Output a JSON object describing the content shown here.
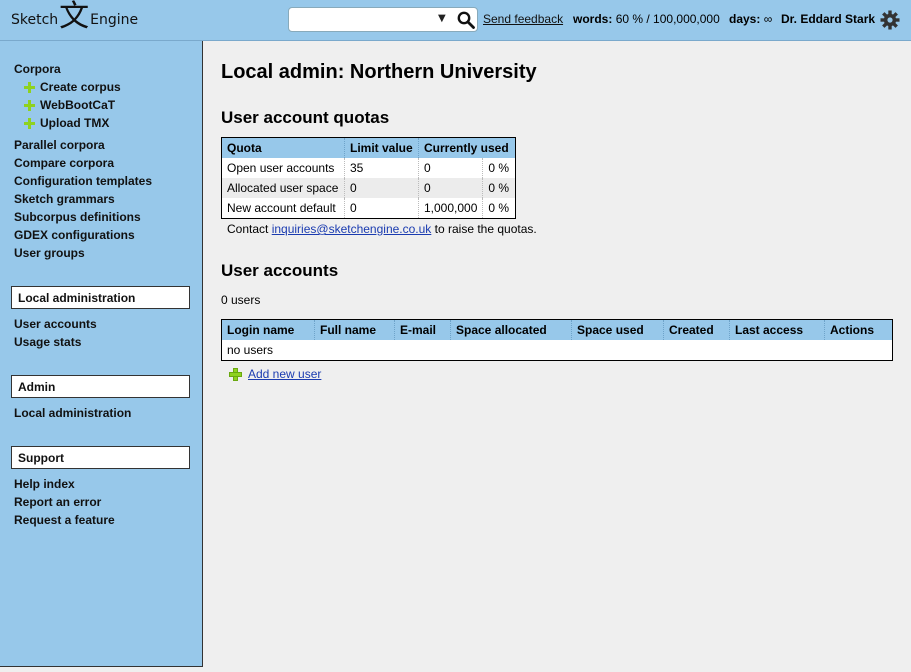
{
  "header": {
    "logo_left": "Sketch",
    "logo_glyph": "文",
    "logo_right": "Engine",
    "search_value": "",
    "feedback_label": "Send feedback",
    "words_label": "words:",
    "words_value": "60 % / 100,000,000",
    "days_label": "days:",
    "days_value": "∞",
    "user_name": "Dr. Eddard Stark"
  },
  "sidebar": {
    "corpora": "Corpora",
    "create_corpus": "Create corpus",
    "webbootcat": "WebBootCaT",
    "upload_tmx": "Upload TMX",
    "parallel_corpora": "Parallel corpora",
    "compare_corpora": "Compare corpora",
    "configuration_templates": "Configuration templates",
    "sketch_grammars": "Sketch grammars",
    "subcorpus_definitions": "Subcorpus definitions",
    "gdex_configurations": "GDEX configurations",
    "user_groups": "User groups",
    "local_admin_box": "Local administration",
    "user_accounts": "User accounts",
    "usage_stats": "Usage stats",
    "admin_box": "Admin",
    "local_administration": "Local administration",
    "support_box": "Support",
    "help_index": "Help index",
    "report_error": "Report an error",
    "request_feature": "Request a feature"
  },
  "main": {
    "title": "Local admin: Northern University",
    "quotas_title": "User account quotas",
    "quota_headers": [
      "Quota",
      "Limit value",
      "Currently used"
    ],
    "quota_rows": [
      {
        "name": "Open user accounts",
        "limit": "35",
        "used": "0",
        "pct": "0 %"
      },
      {
        "name": "Allocated user space",
        "limit": "0",
        "used": "0",
        "pct": "0 %"
      },
      {
        "name": "New account default",
        "limit": "0",
        "used": "1,000,000",
        "pct": "0 %"
      }
    ],
    "contact_prefix": "Contact",
    "contact_email": "inquiries@sketchengine.co.uk",
    "contact_suffix": "to raise the quotas.",
    "accounts_title": "User accounts",
    "user_count": "0 users",
    "users_headers": [
      "Login name",
      "Full name",
      "E-mail",
      "Space allocated",
      "Space used",
      "Created",
      "Last access",
      "Actions"
    ],
    "no_users": "no users",
    "add_user": "Add new user"
  },
  "colors": {
    "header_bg": "#97c8ea",
    "main_bg": "#efefef",
    "accent_plus": "#8ed21f",
    "link": "#1a3bb0"
  }
}
